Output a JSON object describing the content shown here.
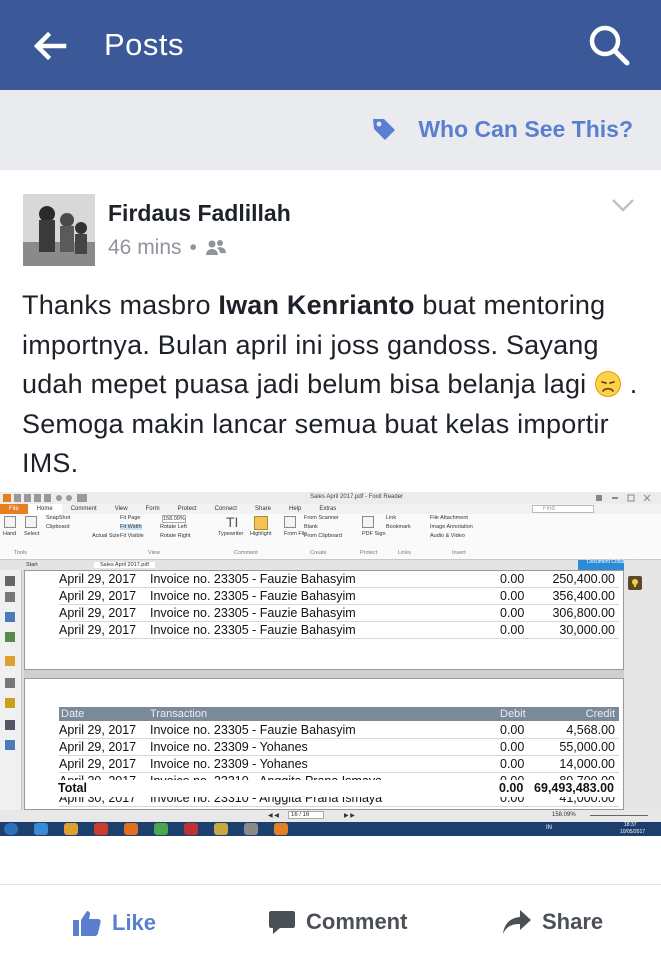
{
  "topbar": {
    "title": "Posts",
    "bg": "#3b5998"
  },
  "privacy": {
    "label": "Who Can See This?"
  },
  "post": {
    "author": "Firdaus Fadlillah",
    "time": "46 mins",
    "separator": "•",
    "text_before": "Thanks masbro ",
    "text_bold": "Iwan Kenrianto",
    "text_middle": " buat mentoring importnya. Bulan april ini joss gandoss. Sayang udah mepet puasa jadi belum bisa belanja lagi ",
    "text_after": " . Semoga makin lancar semua buat kelas importir IMS."
  },
  "screenshot": {
    "window_title": "Sales April 2017.pdf - Foxit Reader",
    "tabs": [
      "File",
      "Home",
      "Comment",
      "View",
      "Form",
      "Protect",
      "Connect",
      "Share",
      "Help",
      "Extras"
    ],
    "doc_tabs": [
      "Start",
      "Sales April 2017.pdf"
    ],
    "collab_label": "Document Collaboration",
    "find_placeholder": "Find",
    "ribbon": {
      "hand": "Hand",
      "select": "Select",
      "snapshot": "SnapShot",
      "clipboard": "Clipboard",
      "actual_size": "Actual Size",
      "fit_page": "Fit Page",
      "fit_width": "Fit Width",
      "fit_visible": "Fit Visible",
      "zoom": "158.09%",
      "rotate_left": "Rotate Left",
      "rotate_right": "Rotate Right",
      "typewriter": "Typewriter",
      "highlight": "Highlight",
      "from_file": "From File",
      "from_scanner": "From Scanner",
      "blank": "Blank",
      "from_clipboard": "From Clipboard",
      "pdf_sign": "PDF Sign",
      "link": "Link",
      "bookmark": "Bookmark",
      "file_attachment": "File Attachment",
      "image_annotation": "Image Annotation",
      "audio_video": "Audio & Video",
      "groups": [
        "Tools",
        "View",
        "Comment",
        "Create",
        "Protect",
        "Links",
        "Insert"
      ]
    },
    "page1_rows": [
      {
        "date": "April 29, 2017",
        "tx": "Invoice no. 23305 - Fauzie Bahasyim",
        "debit": "0.00",
        "credit": "250,400.00"
      },
      {
        "date": "April 29, 2017",
        "tx": "Invoice no. 23305 - Fauzie Bahasyim",
        "debit": "0.00",
        "credit": "356,400.00"
      },
      {
        "date": "April 29, 2017",
        "tx": "Invoice no. 23305 - Fauzie Bahasyim",
        "debit": "0.00",
        "credit": "306,800.00"
      },
      {
        "date": "April 29, 2017",
        "tx": "Invoice no. 23305 - Fauzie Bahasyim",
        "debit": "0.00",
        "credit": "30,000.00"
      }
    ],
    "table_header": {
      "date": "Date",
      "tx": "Transaction",
      "debit": "Debit",
      "credit": "Credit"
    },
    "page2_rows": [
      {
        "date": "April 29, 2017",
        "tx": "Invoice no. 23305 - Fauzie Bahasyim",
        "debit": "0.00",
        "credit": "4,568.00"
      },
      {
        "date": "April 29, 2017",
        "tx": "Invoice no. 23309 - Yohanes",
        "debit": "0.00",
        "credit": "55,000.00"
      },
      {
        "date": "April 29, 2017",
        "tx": "Invoice no. 23309 - Yohanes",
        "debit": "0.00",
        "credit": "14,000.00"
      },
      {
        "date": "April 30, 2017",
        "tx": "Invoice no. 23310 - Anggita Prana Ismaya",
        "debit": "0.00",
        "credit": "89,700.00"
      },
      {
        "date": "April 30, 2017",
        "tx": "Invoice no. 23310 - Anggita Prana Ismaya",
        "debit": "0.00",
        "credit": "41,000.00"
      }
    ],
    "total": {
      "label": "Total",
      "debit": "0.00",
      "credit": "69,493,483.00"
    },
    "page_nav": "16 / 16",
    "zoom_status": "158.09%",
    "clock_time": "18:37",
    "clock_date": "10/05/2017",
    "lang": "IN"
  },
  "actions": {
    "like": "Like",
    "comment": "Comment",
    "share": "Share"
  },
  "colors": {
    "fb_blue": "#3b5998",
    "link_blue": "#5b7fd0",
    "grey_text": "#90949c"
  }
}
